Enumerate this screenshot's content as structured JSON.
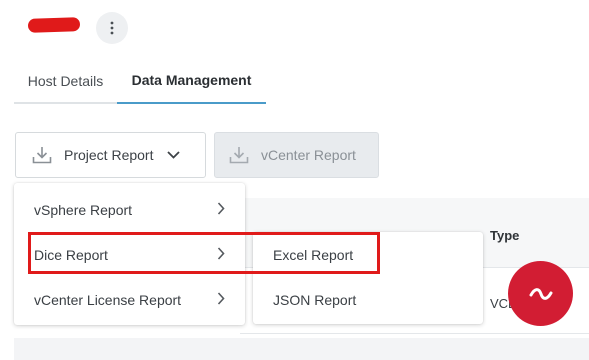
{
  "header": {
    "redaction_color": "#e01a1a",
    "menu_icon": "more-vertical-icon"
  },
  "tabs": [
    {
      "label": "Host Details",
      "active": false
    },
    {
      "label": "Data Management",
      "active": true
    }
  ],
  "toolbar": {
    "project_report": {
      "label": "Project Report",
      "icon": "download-icon",
      "caret": "chevron-down-icon"
    },
    "vcenter_report": {
      "label": "vCenter Report",
      "icon": "download-icon",
      "disabled": true
    }
  },
  "report_menu": {
    "items": [
      {
        "label": "vSphere Report",
        "has_submenu": true
      },
      {
        "label": "Dice Report",
        "has_submenu": true,
        "highlighted": true
      },
      {
        "label": "vCenter License Report",
        "has_submenu": true
      }
    ]
  },
  "dice_submenu": {
    "items": [
      {
        "label": "Excel Report",
        "highlighted": true
      },
      {
        "label": "JSON Report"
      }
    ]
  },
  "table": {
    "columns": {
      "type": "Type"
    },
    "rows": [
      {
        "type": "VCL"
      }
    ]
  },
  "colors": {
    "accent": "#4a9bc9",
    "highlight": "#e01a1a",
    "fab": "#d21d33"
  }
}
